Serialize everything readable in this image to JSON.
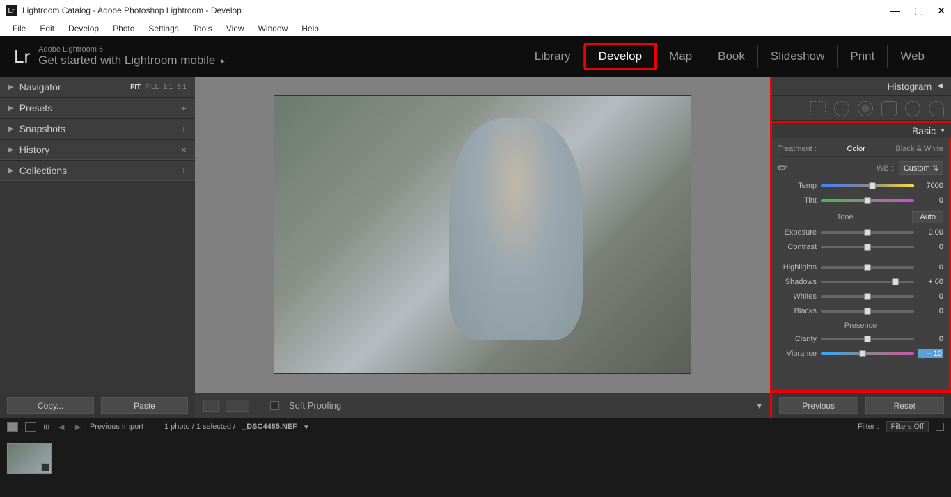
{
  "titlebar": {
    "text": "Lightroom Catalog - Adobe Photoshop Lightroom - Develop",
    "icon": "Lr"
  },
  "menubar": [
    "File",
    "Edit",
    "Develop",
    "Photo",
    "Settings",
    "Tools",
    "View",
    "Window",
    "Help"
  ],
  "header": {
    "logo": "Lr",
    "subtitle": "Adobe Lightroom 6",
    "title": "Get started with Lightroom mobile"
  },
  "modules": [
    "Library",
    "Develop",
    "Map",
    "Book",
    "Slideshow",
    "Print",
    "Web"
  ],
  "active_module": "Develop",
  "left_panels": {
    "navigator": {
      "title": "Navigator",
      "modes": [
        "FIT",
        "FILL",
        "1:1",
        "3:1"
      ]
    },
    "items": [
      {
        "title": "Presets",
        "icon": "+"
      },
      {
        "title": "Snapshots",
        "icon": "+"
      },
      {
        "title": "History",
        "icon": "×"
      },
      {
        "title": "Collections",
        "icon": "+"
      }
    ]
  },
  "left_buttons": {
    "copy": "Copy...",
    "paste": "Paste"
  },
  "toolbar": {
    "soft_proofing": "Soft Proofing"
  },
  "right": {
    "histogram": "Histogram",
    "basic": "Basic",
    "treatment": {
      "label": "Treatment :",
      "color": "Color",
      "bw": "Black & White"
    },
    "wb": {
      "label": "WB :",
      "value": "Custom"
    },
    "sliders": {
      "temp": {
        "label": "Temp",
        "value": "7000",
        "pos": 55
      },
      "tint": {
        "label": "Tint",
        "value": "0",
        "pos": 50
      },
      "exposure": {
        "label": "Exposure",
        "value": "0.00",
        "pos": 50
      },
      "contrast": {
        "label": "Contrast",
        "value": "0",
        "pos": 50
      },
      "highlights": {
        "label": "Highlights",
        "value": "0",
        "pos": 50
      },
      "shadows": {
        "label": "Shadows",
        "value": "+ 60",
        "pos": 80
      },
      "whites": {
        "label": "Whites",
        "value": "0",
        "pos": 50
      },
      "blacks": {
        "label": "Blacks",
        "value": "0",
        "pos": 50
      },
      "clarity": {
        "label": "Clarity",
        "value": "0",
        "pos": 50
      },
      "vibrance": {
        "label": "Vibrance",
        "value": "– 10",
        "pos": 45
      }
    },
    "tone": {
      "label": "Tone",
      "auto": "Auto"
    },
    "presence": "Presence",
    "buttons": {
      "prev": "Previous",
      "reset": "Reset"
    }
  },
  "filmstrip": {
    "previous_import": "Previous Import",
    "count": "1 photo / 1 selected /",
    "filename": "_DSC4485.NEF",
    "filter_label": "Filter :",
    "filter_value": "Filters Off"
  }
}
